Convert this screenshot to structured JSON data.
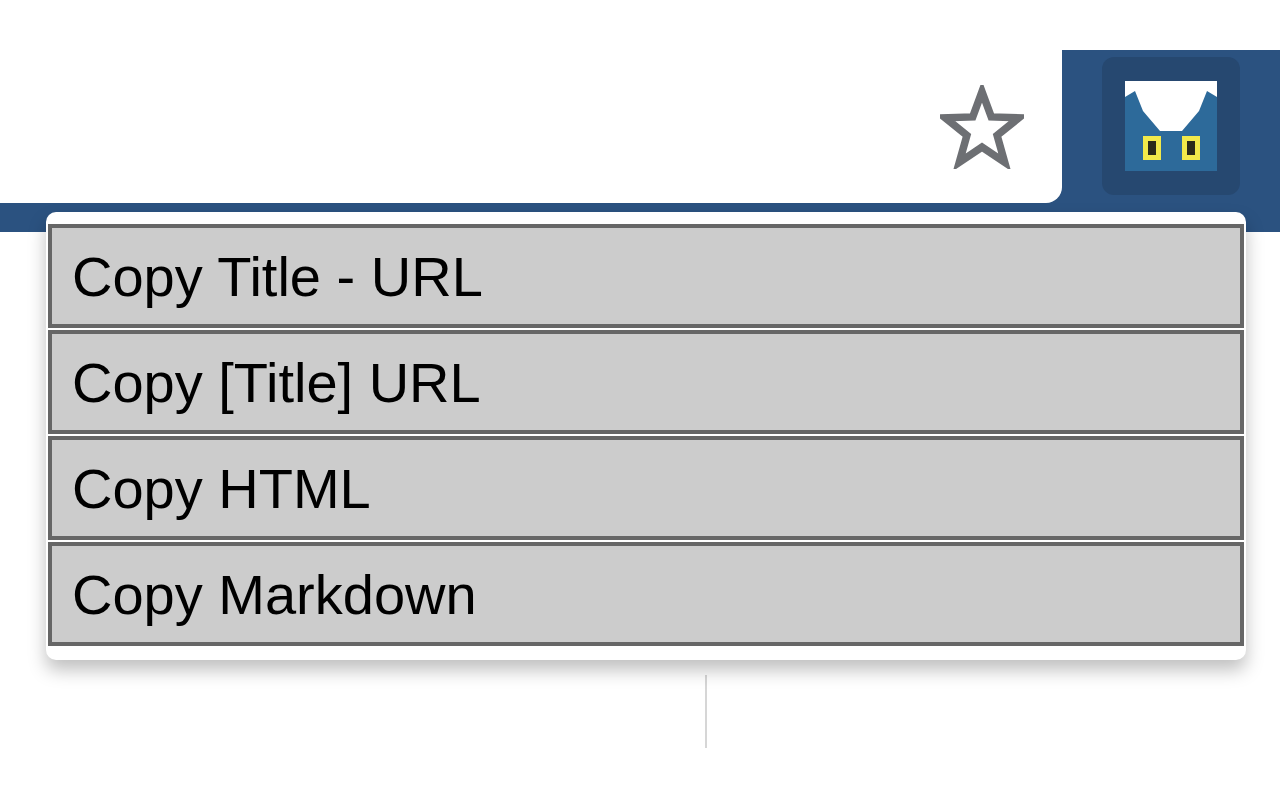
{
  "menu": {
    "items": [
      {
        "label": "Copy Title - URL"
      },
      {
        "label": "Copy [Title] URL"
      },
      {
        "label": "Copy HTML"
      },
      {
        "label": "Copy Markdown"
      }
    ]
  }
}
